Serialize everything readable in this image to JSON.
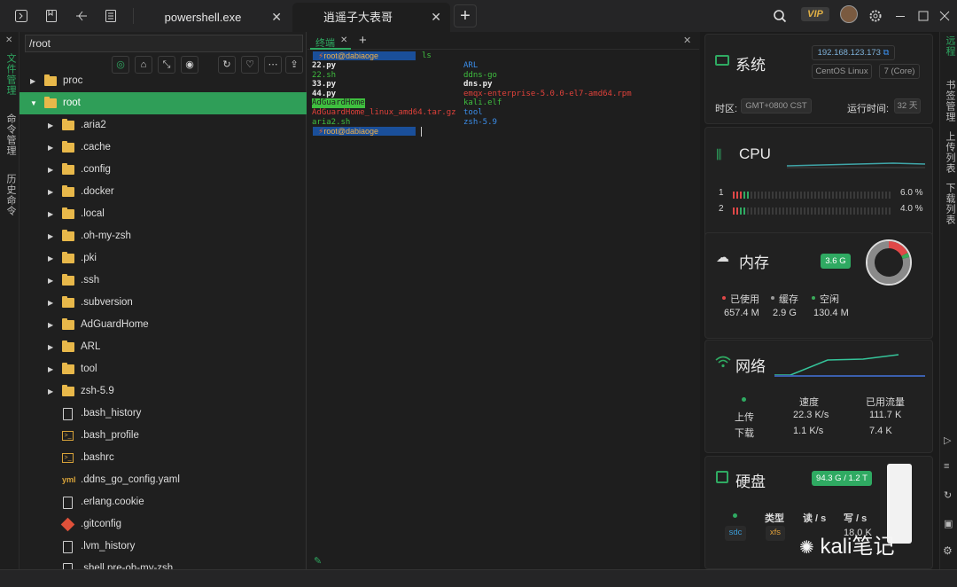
{
  "titlebar": {
    "tabs": [
      {
        "label": "powershell.exe"
      },
      {
        "label": "逍遥子大表哥"
      }
    ],
    "vip": "VIP"
  },
  "left_strip": [
    "文件管理",
    "命令管理",
    "历史命令"
  ],
  "files": {
    "path": "/root",
    "rows": [
      {
        "name": "proc",
        "type": "folder",
        "level": 1
      },
      {
        "name": "root",
        "type": "folder",
        "level": 1,
        "selected": true
      },
      {
        "name": ".aria2",
        "type": "folder",
        "level": 2
      },
      {
        "name": ".cache",
        "type": "folder",
        "level": 2
      },
      {
        "name": ".config",
        "type": "folder",
        "level": 2
      },
      {
        "name": ".docker",
        "type": "folder",
        "level": 2
      },
      {
        "name": ".local",
        "type": "folder",
        "level": 2
      },
      {
        "name": ".oh-my-zsh",
        "type": "folder",
        "level": 2
      },
      {
        "name": ".pki",
        "type": "folder",
        "level": 2
      },
      {
        "name": ".ssh",
        "type": "folder",
        "level": 2
      },
      {
        "name": ".subversion",
        "type": "folder",
        "level": 2
      },
      {
        "name": "AdGuardHome",
        "type": "folder",
        "level": 2
      },
      {
        "name": "ARL",
        "type": "folder",
        "level": 2
      },
      {
        "name": "tool",
        "type": "folder",
        "level": 2
      },
      {
        "name": "zsh-5.9",
        "type": "folder",
        "level": 2
      },
      {
        "name": ".bash_history",
        "type": "file",
        "level": 2
      },
      {
        "name": ".bash_profile",
        "type": "term",
        "level": 2
      },
      {
        "name": ".bashrc",
        "type": "term",
        "level": 2
      },
      {
        "name": ".ddns_go_config.yaml",
        "type": "yaml",
        "level": 2
      },
      {
        "name": ".erlang.cookie",
        "type": "file",
        "level": 2
      },
      {
        "name": ".gitconfig",
        "type": "git",
        "level": 2
      },
      {
        "name": ".lvm_history",
        "type": "file",
        "level": 2
      },
      {
        "name": ".shell.pre-oh-my-zsh",
        "type": "file",
        "level": 2
      }
    ]
  },
  "terminal": {
    "tab_label": "终端",
    "prompt": "root@dabiaoge",
    "command": "ls",
    "col1": [
      {
        "text": "22.py",
        "color": "#e8e8e8",
        "bold": true
      },
      {
        "text": "22.sh",
        "color": "#3fbf3f"
      },
      {
        "text": "33.py",
        "color": "#e8e8e8",
        "bold": true
      },
      {
        "text": "44.py",
        "color": "#e8e8e8",
        "bold": true
      },
      {
        "text": "AdGuardHome",
        "color": "#1e1e1e",
        "bg": "#3fbf3f"
      },
      {
        "text": "AdGuardHome_linux_amd64.tar.gz",
        "color": "#e0413a"
      },
      {
        "text": "aria2.sh",
        "color": "#3fbf3f"
      }
    ],
    "col2": [
      {
        "text": "ARL",
        "color": "#3b8eea"
      },
      {
        "text": "ddns-go",
        "color": "#3fbf3f"
      },
      {
        "text": "dns.py",
        "color": "#e8e8e8",
        "bold": true
      },
      {
        "text": "emqx-enterprise-5.0.0-el7-amd64.rpm",
        "color": "#e0413a"
      },
      {
        "text": "kali.elf",
        "color": "#3fbf3f"
      },
      {
        "text": "tool",
        "color": "#3b8eea"
      },
      {
        "text": "zsh-5.9",
        "color": "#3b8eea"
      }
    ]
  },
  "system": {
    "title": "系统",
    "ip": "192.168.123.173",
    "os": "CentOS Linux",
    "version": "7 (Core)",
    "tz_label": "时区:",
    "tz": "GMT+0800  CST",
    "uptime_label": "运行时间:",
    "uptime": "32 天"
  },
  "cpu": {
    "title": "CPU",
    "cores": [
      {
        "id": "1",
        "pct": "6.0 %",
        "value": 6.0
      },
      {
        "id": "2",
        "pct": "4.0 %",
        "value": 4.0
      }
    ]
  },
  "memory": {
    "title": "内存",
    "total": "3.6 G",
    "legend": [
      {
        "label": "已使用",
        "value": "657.4 M",
        "color": "#e04848"
      },
      {
        "label": "缓存",
        "value": "2.9 G",
        "color": "#9a9a9a"
      },
      {
        "label": "空闲",
        "value": "130.4 M",
        "color": "#3aaa5a"
      }
    ],
    "donut": [
      657.4,
      2969.6,
      130.4
    ]
  },
  "network": {
    "title": "网络",
    "headers": [
      "速度",
      "已用流量"
    ],
    "rows": [
      {
        "label": "上传",
        "speed": "22.3 K/s",
        "used": "111.7 K"
      },
      {
        "label": "下载",
        "speed": "1.1 K/s",
        "used": "7.4 K"
      }
    ]
  },
  "disk": {
    "title": "硬盘",
    "total": "94.3 G / 1.2 T",
    "headers": [
      "类型",
      "读 / s",
      "写 / s"
    ],
    "device": "sdc",
    "fstype": "xfs",
    "write": "18.0 K"
  },
  "right_strip": [
    "书签管理",
    "上传列表",
    "下载列表",
    "远程"
  ],
  "watermark": "kali笔记",
  "colors": {
    "accent": "#2f9e58",
    "prompt_bg": "#1a4f9a"
  }
}
